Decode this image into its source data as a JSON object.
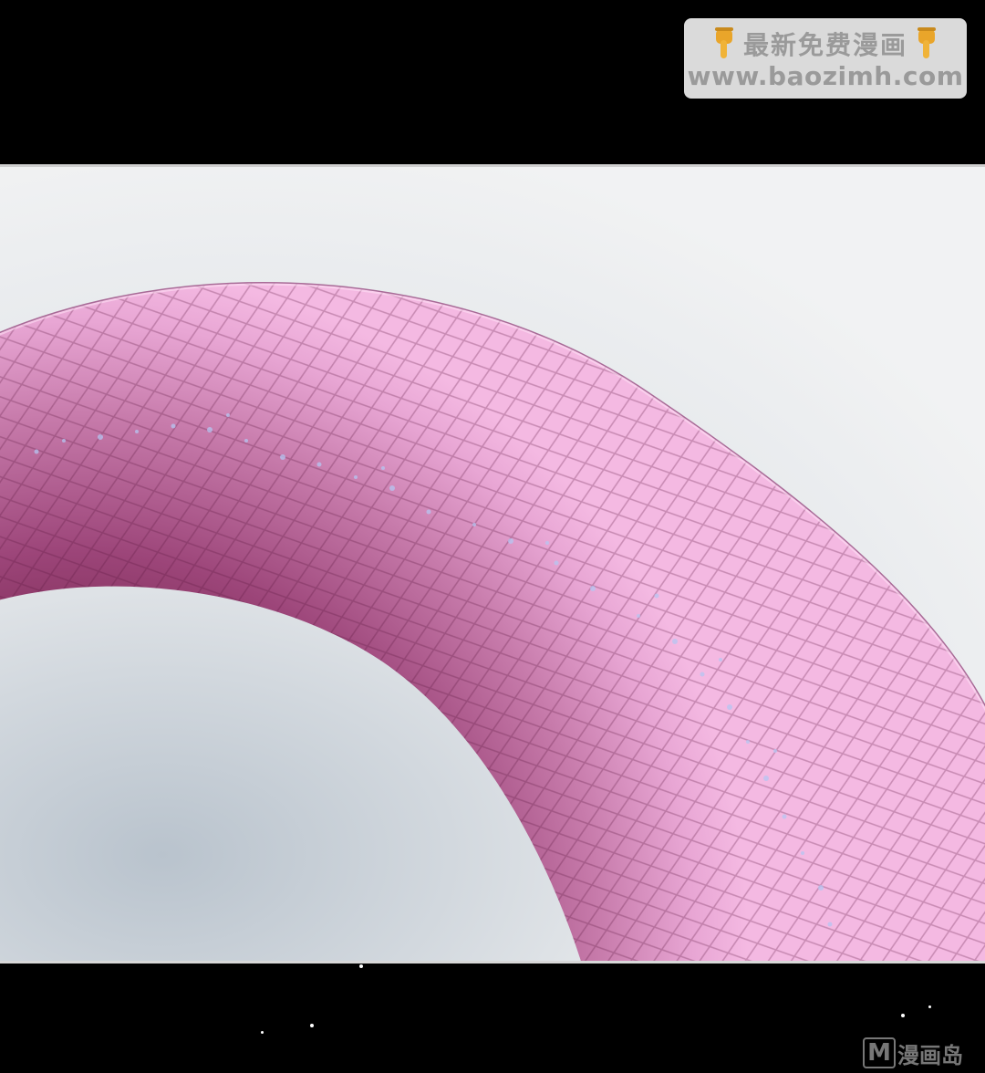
{
  "watermark": {
    "title": "最新免费漫画",
    "url": "www.baozimh.com",
    "left_icon": "pointing-down-hand-icon",
    "right_icon": "pointing-down-hand-icon"
  },
  "corner_logo": {
    "letter": "M",
    "text": "漫画岛"
  },
  "colors": {
    "background": "#000000",
    "sky": "#e9ecef",
    "serpent_light": "#f2b2de",
    "serpent_dark": "#8c3a66",
    "sparkle": "#b6c6f2",
    "watermark_text": "#9a9a9a"
  }
}
